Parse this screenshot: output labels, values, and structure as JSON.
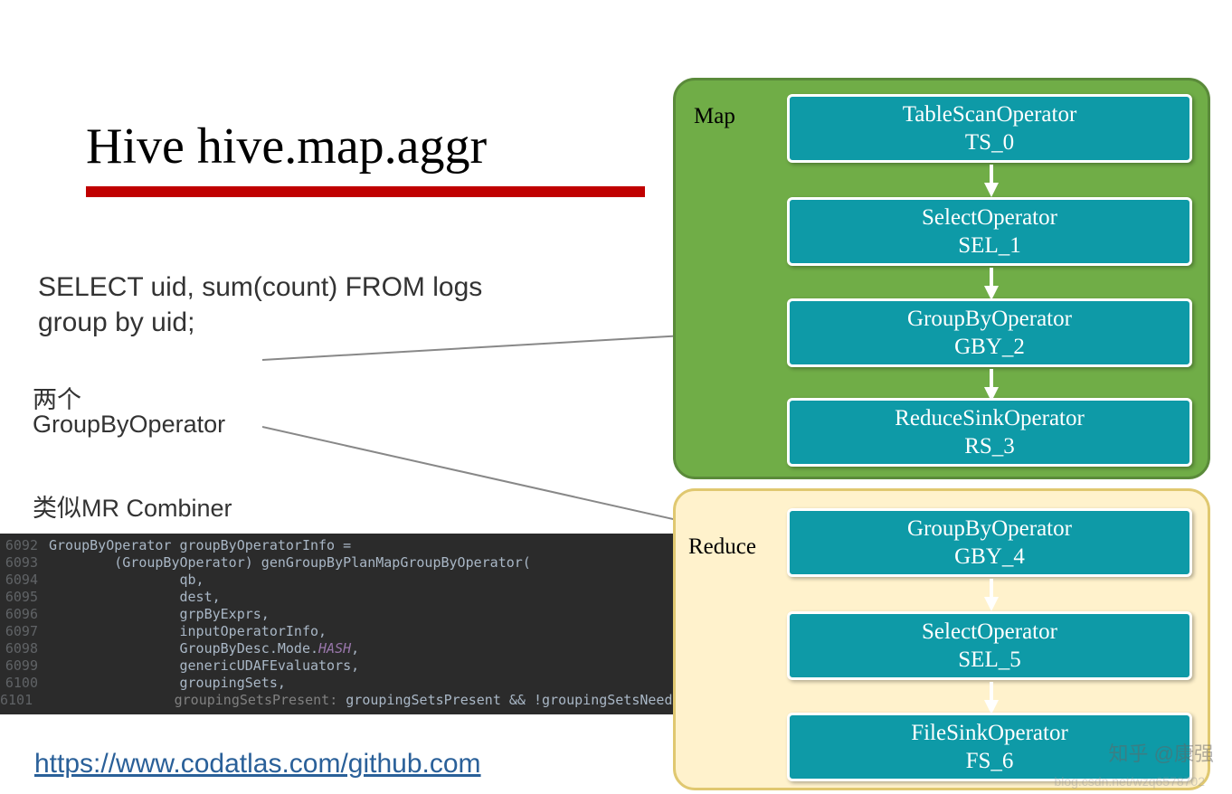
{
  "title": "Hive hive.map.aggr",
  "sql": {
    "line1": "SELECT uid, sum(count) FROM logs",
    "line2": "group by uid;"
  },
  "labels": {
    "two": "两个",
    "gbo": "GroupByOperator",
    "combiner": "类似MR Combiner"
  },
  "code": {
    "lines": [
      {
        "no": "6092",
        "text": "GroupByOperator groupByOperatorInfo ="
      },
      {
        "no": "6093",
        "text": "        (GroupByOperator) genGroupByPlanMapGroupByOperator("
      },
      {
        "no": "6094",
        "text": "                qb,"
      },
      {
        "no": "6095",
        "text": "                dest,"
      },
      {
        "no": "6096",
        "text": "                grpByExprs,"
      },
      {
        "no": "6097",
        "text": "                inputOperatorInfo,"
      },
      {
        "no": "6098",
        "text": "                GroupByDesc.Mode.",
        "hash": "HASH",
        "tail": ","
      },
      {
        "no": "6099",
        "text": "                genericUDAFEvaluators,"
      },
      {
        "no": "6100",
        "text": "                groupingSets,"
      },
      {
        "no": "6101",
        "param": "                groupingSetsPresent:",
        "text": " groupingSetsPresent && !groupingSetsNeedAdditionalMRJob);"
      }
    ]
  },
  "link": "https://www.codatlas.com/github.com",
  "stages": {
    "map": "Map",
    "reduce": "Reduce"
  },
  "operators": {
    "ts": {
      "name": "TableScanOperator",
      "id": "TS_0"
    },
    "sel1": {
      "name": "SelectOperator",
      "id": "SEL_1"
    },
    "gby2": {
      "name": "GroupByOperator",
      "id": "GBY_2"
    },
    "rs3": {
      "name": "ReduceSinkOperator",
      "id": "RS_3"
    },
    "gby4": {
      "name": "GroupByOperator",
      "id": "GBY_4"
    },
    "sel5": {
      "name": "SelectOperator",
      "id": "SEL_5"
    },
    "fs6": {
      "name": "FileSinkOperator",
      "id": "FS_6"
    }
  },
  "watermarks": {
    "zhihu": "知乎 @康强",
    "csdn": "blog.csdn.net/wzq6578702"
  }
}
